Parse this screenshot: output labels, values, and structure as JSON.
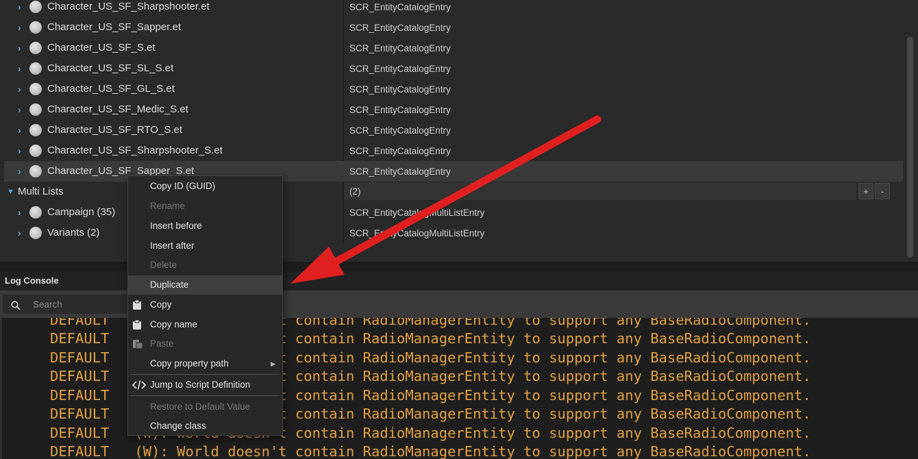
{
  "tree": {
    "rows": [
      {
        "label": "Character_US_SF_Sharpshooter.et",
        "type": "SCR_EntityCatalogEntry"
      },
      {
        "label": "Character_US_SF_Sapper.et",
        "type": "SCR_EntityCatalogEntry"
      },
      {
        "label": "Character_US_SF_S.et",
        "type": "SCR_EntityCatalogEntry"
      },
      {
        "label": "Character_US_SF_SL_S.et",
        "type": "SCR_EntityCatalogEntry"
      },
      {
        "label": "Character_US_SF_GL_S.et",
        "type": "SCR_EntityCatalogEntry"
      },
      {
        "label": "Character_US_SF_Medic_S.et",
        "type": "SCR_EntityCatalogEntry"
      },
      {
        "label": "Character_US_SF_RTO_S.et",
        "type": "SCR_EntityCatalogEntry"
      },
      {
        "label": "Character_US_SF_Sharpshooter_S.et",
        "type": "SCR_EntityCatalogEntry"
      },
      {
        "label": "Character_US_SF_Sapper_S.et",
        "type": "SCR_EntityCatalogEntry"
      }
    ],
    "multi_lists": {
      "label": "Multi Lists",
      "count_value": "(2)",
      "add_label": "+",
      "remove_label": "-",
      "children": [
        {
          "label": "Campaign (35)",
          "type": "SCR_EntityCatalogMultiListEntry"
        },
        {
          "label": "Variants (2)",
          "type": "SCR_EntityCatalogMultiListEntry"
        }
      ]
    }
  },
  "context_menu": {
    "items": [
      {
        "label": "Copy ID (GUID)"
      },
      {
        "label": "Rename"
      },
      {
        "label": "Insert before"
      },
      {
        "label": "Insert after"
      },
      {
        "label": "Delete"
      },
      {
        "label": "Duplicate"
      },
      {
        "label": "Copy"
      },
      {
        "label": "Copy name"
      },
      {
        "label": "Paste"
      },
      {
        "label": "Copy property path"
      },
      {
        "label": "Jump to Script Definition"
      },
      {
        "label": "Restore to Default Value"
      },
      {
        "label": "Change class"
      }
    ]
  },
  "log_console": {
    "title": "Log Console",
    "search_placeholder": "Search",
    "lines": [
      {
        "level": "DEFAULT",
        "msg": "   (W): World doesn't contain RadioManagerEntity to support any BaseRadioComponent."
      },
      {
        "level": "DEFAULT",
        "msg": "   (W): World doesn't contain RadioManagerEntity to support any BaseRadioComponent."
      },
      {
        "level": "DEFAULT",
        "msg": "   (W): World doesn't contain RadioManagerEntity to support any BaseRadioComponent."
      },
      {
        "level": "DEFAULT",
        "msg": "   (W): World doesn't contain RadioManagerEntity to support any BaseRadioComponent."
      },
      {
        "level": "DEFAULT",
        "msg": "   (W): World doesn't contain RadioManagerEntity to support any BaseRadioComponent."
      },
      {
        "level": "DEFAULT",
        "msg": "   (W): World doesn't contain RadioManagerEntity to support any BaseRadioComponent."
      },
      {
        "level": "DEFAULT",
        "msg": "   (W): World doesn't contain RadioManagerEntity to support any BaseRadioComponent."
      },
      {
        "level": "DEFAULT",
        "msg": "   (W): World doesn't contain RadioManagerEntity to support any BaseRadioComponent."
      }
    ]
  },
  "colors": {
    "accent": "#52a7ea",
    "log_text": "#e2a042",
    "arrow": "#e02020"
  }
}
